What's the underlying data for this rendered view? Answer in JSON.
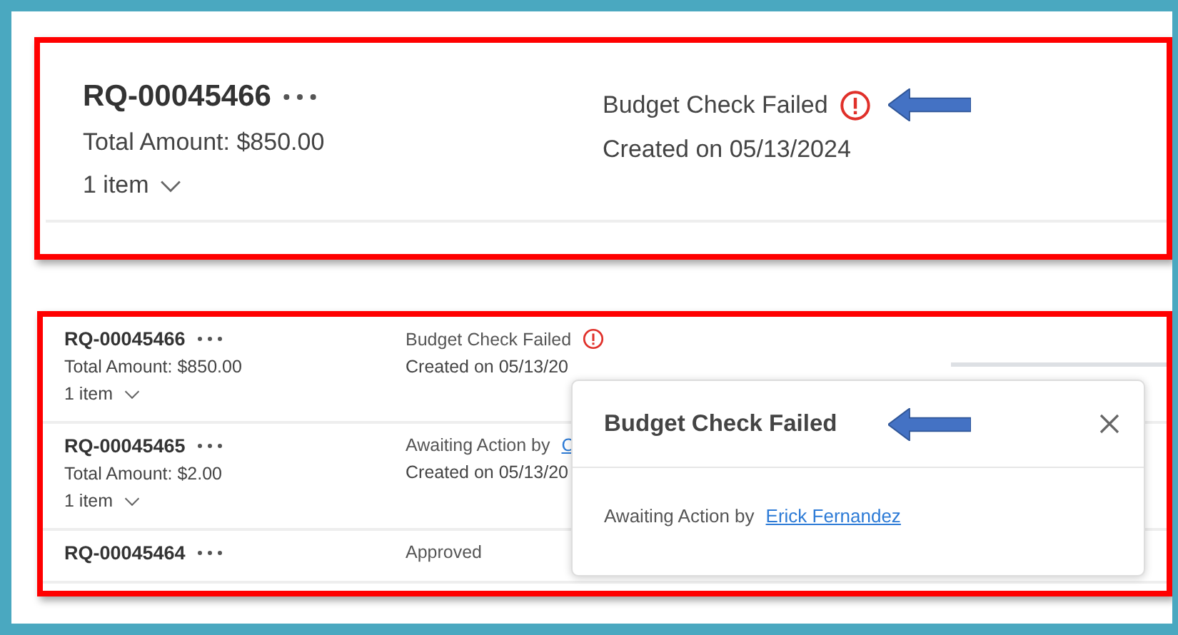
{
  "top_card": {
    "id": "RQ-00045466",
    "total": "Total Amount: $850.00",
    "items": "1 item",
    "status": "Budget Check Failed",
    "created": "Created on 05/13/2024",
    "kind": "failed",
    "annotated": true
  },
  "rows": [
    {
      "id": "RQ-00045466",
      "total": "Total Amount: $850.00",
      "items": "1 item",
      "status": "Budget Check Failed",
      "created": "Created on 05/13/20",
      "kind": "failed"
    },
    {
      "id": "RQ-00045465",
      "total": "Total Amount: $2.00",
      "items": "1 item",
      "status": "Awaiting Action by",
      "link": "C",
      "created": "Created on 05/13/20",
      "kind": "awaiting"
    },
    {
      "id": "RQ-00045464",
      "status": "Approved",
      "kind": "approved"
    }
  ],
  "popover": {
    "title": "Budget Check Failed",
    "body": "Awaiting Action by",
    "link": "Erick Fernandez",
    "annotated": true
  }
}
